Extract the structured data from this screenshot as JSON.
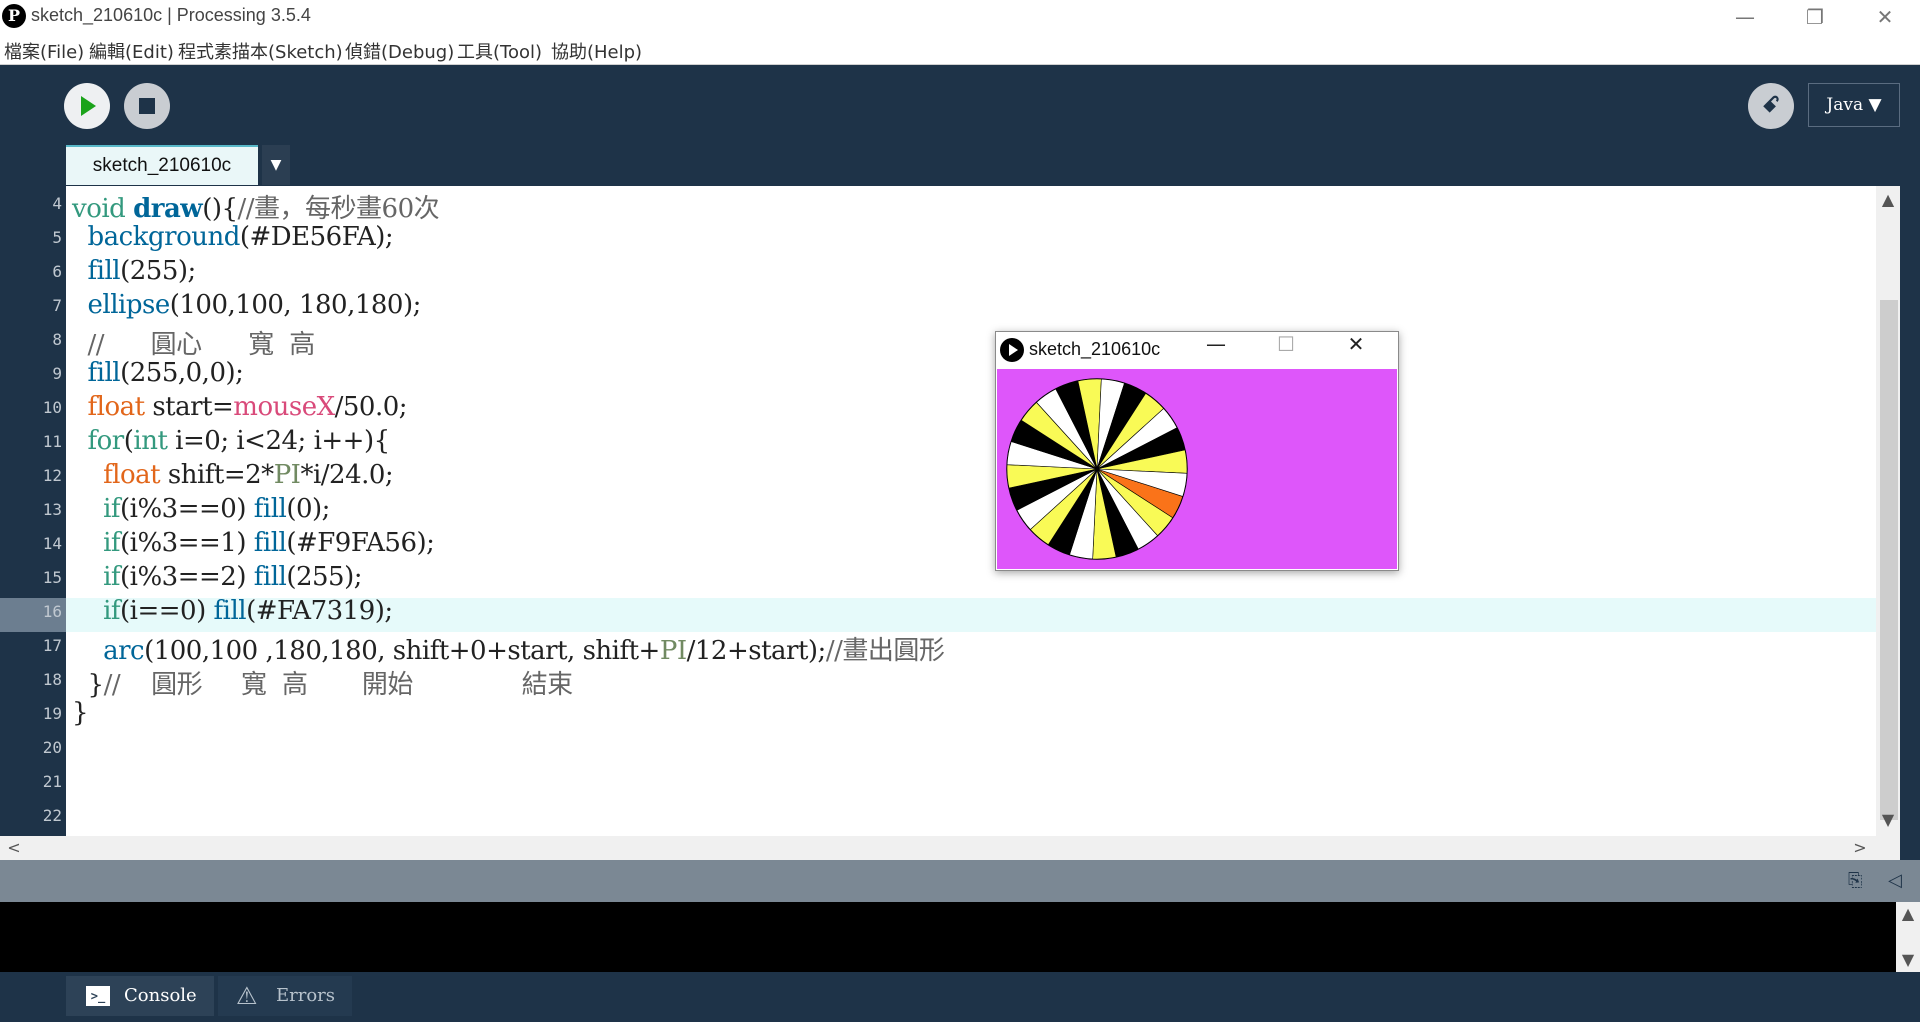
{
  "window": {
    "title": "sketch_210610c | Processing 3.5.4",
    "logo_glyph": "P",
    "minimize_glyph": "—",
    "restore_glyph": "❐",
    "close_glyph": "✕"
  },
  "menu": [
    "檔案(File)",
    "編輯(Edit)",
    "程式素描本(Sketch)",
    "偵錯(Debug)",
    "工具(Tool)",
    "協助(Help)"
  ],
  "toolbar": {
    "mode_label": "Java ▼",
    "debug_glyph": "ꗃ"
  },
  "tabs": {
    "active": "sketch_210610c",
    "menu_glyph": "▼"
  },
  "editor": {
    "line_numbers": [
      "4",
      "5",
      "6",
      "7",
      "8",
      "9",
      "10",
      "11",
      "12",
      "13",
      "14",
      "15",
      "16",
      "17",
      "18",
      "19",
      "20",
      "21",
      "22"
    ],
    "current_line": "16",
    "code_lines": [
      "void draw(){//畫，每秒畫60次",
      "  background(#DE56FA);",
      "  fill(255);",
      "  ellipse(100,100, 180,180);",
      "  //      圓心      寬  高",
      "  fill(255,0,0);",
      "  float start=mouseX/50.0;",
      "  for(int i=0; i<24; i++){",
      "    float shift=2*PI*i/24.0;",
      "    if(i%3==0) fill(0);",
      "    if(i%3==1) fill(#F9FA56);",
      "    if(i%3==2) fill(255);",
      "    if(i==0) fill(#FA7319);",
      "    arc(100,100 ,180,180, shift+0+start, shift+PI/12+start);//畫出圓形",
      "  }//    圓形     寬  高       開始              結束",
      "}",
      "",
      "",
      ""
    ]
  },
  "scroll": {
    "up": "▲",
    "down": "▼",
    "left": "<",
    "right": ">"
  },
  "console_tabs": {
    "console": "Console",
    "errors": "Errors",
    "console_glyph": ">_",
    "errors_glyph": "⚠"
  },
  "sketch_window": {
    "title": "sketch_210610c",
    "minimize_glyph": "—",
    "maximize_glyph": "☐",
    "close_glyph": "✕",
    "background_color": "#DE56FA",
    "wedge_colors": [
      "#000000",
      "#F9FA56",
      "#FFFFFF"
    ],
    "first_wedge_color": "#FA7319"
  },
  "colors": {
    "ide_background": "#1e3348",
    "keyword_green": "#33997e",
    "function_blue": "#006699",
    "constant_orange": "#e2661a"
  }
}
